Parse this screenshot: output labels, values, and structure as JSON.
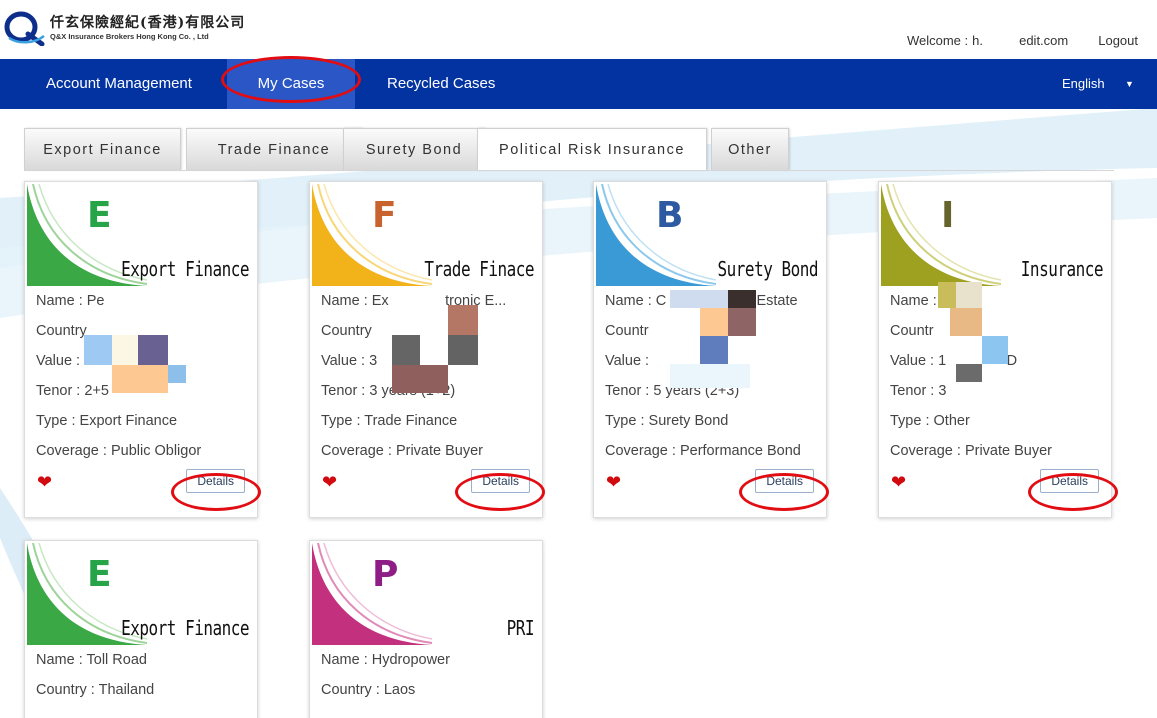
{
  "header": {
    "logo_cn": "仟玄保險經紀(香港)有限公司",
    "logo_en": "Q&X Insurance Brokers Hong Kong Co. , Ltd",
    "welcome_label": "Welcome :",
    "welcome_user": "h.          edit.com",
    "logout_label": "Logout"
  },
  "nav": {
    "account": "Account Management",
    "my_cases": "My Cases",
    "recycled": "Recycled Cases",
    "language": "English",
    "caret": "▼"
  },
  "tabs": [
    "Export Finance",
    "Trade Finance",
    "Surety Bond",
    "Political Risk Insurance",
    "Other"
  ],
  "cards": [
    {
      "letter": "E",
      "category": "Export Finance",
      "name": "Name : Pe",
      "country": "Country",
      "value": "Value :",
      "tenor": "Tenor : 2+5",
      "type": "Type : Export Finance",
      "coverage": "Coverage : Public Obligor",
      "details": "Details"
    },
    {
      "letter": "F",
      "category": "Trade Finace",
      "name": "Name : Ex              tronic E...",
      "country": "Country",
      "value": "Value : 3",
      "tenor": "Tenor : 3 years (1+2)",
      "type": "Type : Trade Finance",
      "coverage": "Coverage : Private Buyer",
      "details": "Details"
    },
    {
      "letter": "B",
      "category": "Surety Bond",
      "name": "Name : C              Real Estate",
      "country": "Countr",
      "value": "Value :",
      "tenor": "Tenor : 5 years (2+3)",
      "type": "Type : Surety Bond",
      "coverage": "Coverage : Performance Bond",
      "details": "Details"
    },
    {
      "letter": "I",
      "category": "Insurance",
      "name": "Name :",
      "country": "Countr",
      "value": "Value : 1               D",
      "tenor": "Tenor : 3",
      "type": "Type : Other",
      "coverage": "Coverage : Private Buyer",
      "details": "Details"
    },
    {
      "letter": "E",
      "category": "Export Finance",
      "name": "Name : Toll Road",
      "country": "Country : Thailand"
    },
    {
      "letter": "P",
      "category": "PRI",
      "name": "Name : Hydropower",
      "country": "Country : Laos"
    }
  ],
  "colors": {
    "nav_bg": "#0333a0",
    "nav_active": "#2a56c6",
    "annotation_ring": "#e10d13",
    "heart": "#d10a0f",
    "export_finance": "#3aa845",
    "trade_finance": "#f2b21a",
    "surety_bond": "#3a9ad6",
    "insurance": "#9ea01f",
    "pri": "#c2307e"
  },
  "icons": {
    "favorite": "heart-icon",
    "dropdown": "caret-down-icon",
    "logo": "qx-logo-icon"
  }
}
